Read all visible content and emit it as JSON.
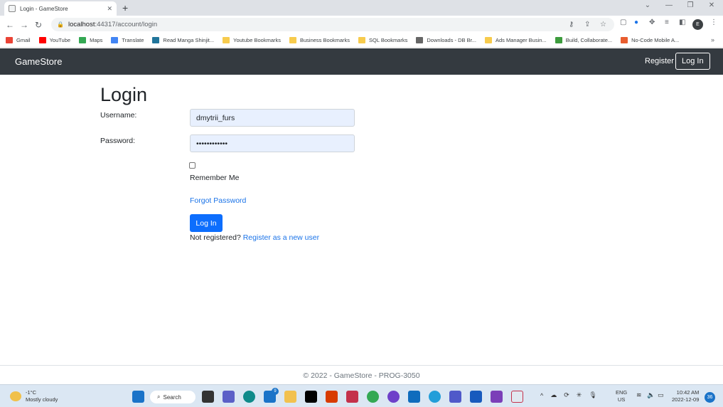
{
  "browser": {
    "tab_title": "Login - GameStore",
    "tab_close": "✕",
    "new_tab": "+",
    "url_host": "localhost",
    "url_path": ":44317/account/login",
    "win_minimize": "—",
    "win_restore": "❐",
    "win_close": "✕",
    "win_chevron": "⌄",
    "profile_letter": "E",
    "bookmarks": [
      {
        "label": "Gmail",
        "color": "#ea4335"
      },
      {
        "label": "YouTube",
        "color": "#ff0000"
      },
      {
        "label": "Maps",
        "color": "#34a853"
      },
      {
        "label": "Translate",
        "color": "#4285f4"
      },
      {
        "label": "Read Manga Shinjit...",
        "color": "#21759b"
      },
      {
        "label": "Youtube Bookmarks",
        "color": "#f7cb4d"
      },
      {
        "label": "Business Bookmarks",
        "color": "#f7cb4d"
      },
      {
        "label": "SQL Bookmarks",
        "color": "#f7cb4d"
      },
      {
        "label": "Downloads - DB Br...",
        "color": "#666666"
      },
      {
        "label": "Ads Manager Busin...",
        "color": "#f7cb4d"
      },
      {
        "label": "Build, Collaborate...",
        "color": "#3d9c3d"
      },
      {
        "label": "No-Code Mobile A...",
        "color": "#e85d2f"
      }
    ],
    "bookmarks_more": "»"
  },
  "site": {
    "brand": "GameStore",
    "nav_register": "Register",
    "nav_login": "Log In"
  },
  "login": {
    "title": "Login",
    "username_label": "Username:",
    "username_value": "dmytrii_furs",
    "password_label": "Password:",
    "password_value": "password1234",
    "remember_label": "Remember Me",
    "forgot_link": "Forgot Password",
    "submit_label": "Log In",
    "not_registered": "Not registered? ",
    "register_link": "Register as a new user"
  },
  "footer": {
    "text": "© 2022 - GameStore - PROG-3050"
  },
  "taskbar": {
    "temp": "-1°C",
    "weather": "Mostly cloudy",
    "search": "Search",
    "lang_top": "ENG",
    "lang_bottom": "US",
    "time": "10:42 AM",
    "date": "2022-12-09",
    "notif_count": "36",
    "mail_badge": "9"
  }
}
